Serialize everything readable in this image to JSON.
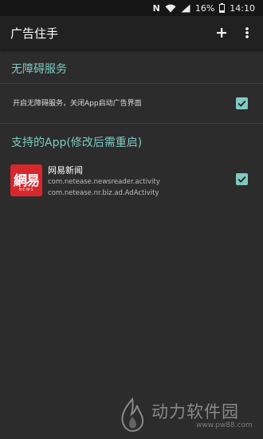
{
  "status_bar": {
    "nfc": "N",
    "battery_percent": "16%",
    "time": "14:10"
  },
  "app_bar": {
    "title": "广告住手",
    "add_icon": "plus-icon",
    "more_icon": "more-vert-icon"
  },
  "accessibility": {
    "header": "无障碍服务",
    "label": "开启无障碍服务，关闭App启动广告界面",
    "checked": true
  },
  "apps": {
    "header": "支持的App(修改后需重启)",
    "items": [
      {
        "name": "网易新闻",
        "activity1": "com.netease.newsreader.activity",
        "activity2": "com.netease.nr.biz.ad.AdActivity",
        "logo_text": "網易",
        "logo_sub": "NEWS",
        "checked": true
      }
    ]
  },
  "watermark": {
    "text": "动力软件园",
    "url": "www.pw88.com"
  },
  "colors": {
    "accent": "#7fc9c0",
    "background": "#2c2c2c",
    "app_bar": "#212121",
    "status_bar": "#161616",
    "netease_red": "#d8262d"
  }
}
